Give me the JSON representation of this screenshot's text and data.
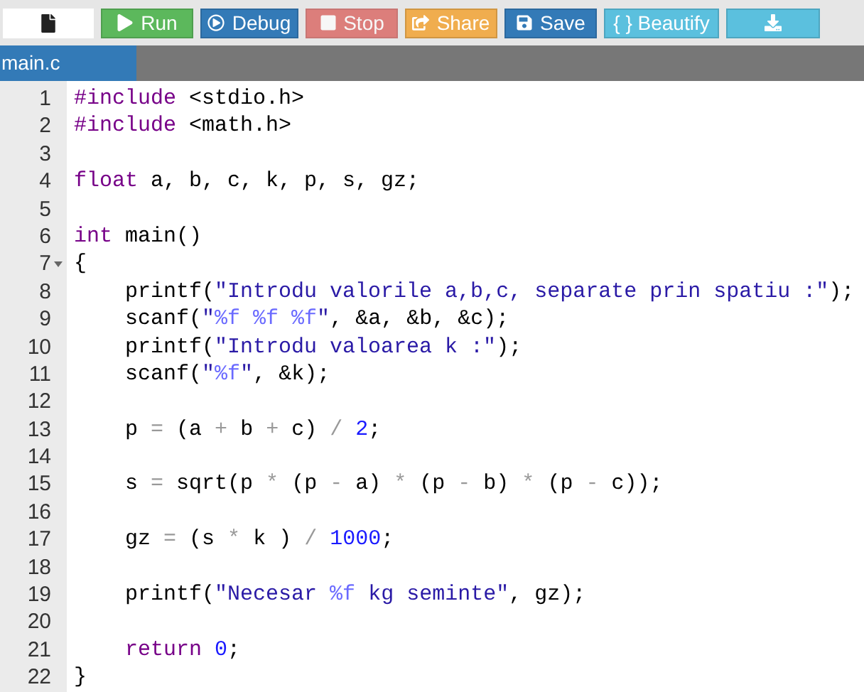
{
  "toolbar": {
    "buttons": [
      {
        "kind": "file",
        "disabled": false
      },
      {
        "kind": "run",
        "label": "Run",
        "disabled": false
      },
      {
        "kind": "debug",
        "label": "Debug",
        "disabled": false
      },
      {
        "kind": "stop",
        "label": "Stop",
        "disabled": true
      },
      {
        "kind": "share",
        "label": "Share",
        "disabled": false
      },
      {
        "kind": "save",
        "label": "Save",
        "disabled": false
      },
      {
        "kind": "beautify",
        "label": "{ } Beautify",
        "disabled": false
      },
      {
        "kind": "download",
        "disabled": false
      }
    ]
  },
  "tabs": [
    {
      "label": "main.c",
      "selected": true
    }
  ],
  "editor": {
    "lines": [
      {
        "number": "1",
        "foldable": false,
        "tokens": [
          {
            "kind": "meta",
            "text": "#include"
          },
          {
            "kind": "plain",
            "text": " <stdio.h>"
          }
        ]
      },
      {
        "number": "2",
        "foldable": false,
        "tokens": [
          {
            "kind": "meta",
            "text": "#include"
          },
          {
            "kind": "plain",
            "text": " <math.h>"
          }
        ]
      },
      {
        "number": "3",
        "foldable": false
      },
      {
        "number": "4",
        "foldable": false,
        "tokens": [
          {
            "kind": "keyword",
            "text": "float"
          },
          {
            "kind": "plain",
            "text": " a, b, c, k, p, s, gz;"
          }
        ]
      },
      {
        "number": "5",
        "foldable": false
      },
      {
        "number": "6",
        "foldable": false,
        "tokens": [
          {
            "kind": "keyword",
            "text": "int"
          },
          {
            "kind": "plain",
            "text": " main()"
          }
        ]
      },
      {
        "number": "7",
        "foldable": true,
        "tokens": [
          {
            "kind": "plain",
            "text": "{"
          }
        ]
      },
      {
        "number": "8",
        "foldable": false,
        "tokens": [
          {
            "kind": "plain",
            "text": "    printf("
          },
          {
            "kind": "string",
            "text": "\"Introdu valorile a,b,c, separate prin spatiu :\""
          },
          {
            "kind": "plain",
            "text": ");"
          }
        ]
      },
      {
        "number": "9",
        "foldable": false,
        "tokens": [
          {
            "kind": "plain",
            "text": "    scanf("
          },
          {
            "kind": "string",
            "text": "\""
          },
          {
            "kind": "format",
            "text": "%f %f %f"
          },
          {
            "kind": "string",
            "text": "\""
          },
          {
            "kind": "plain",
            "text": ", &a, &b, &c);"
          }
        ]
      },
      {
        "number": "10",
        "foldable": false,
        "tokens": [
          {
            "kind": "plain",
            "text": "    printf("
          },
          {
            "kind": "string",
            "text": "\"Introdu valoarea k :\""
          },
          {
            "kind": "plain",
            "text": ");"
          }
        ]
      },
      {
        "number": "11",
        "foldable": false,
        "tokens": [
          {
            "kind": "plain",
            "text": "    scanf("
          },
          {
            "kind": "string",
            "text": "\""
          },
          {
            "kind": "format",
            "text": "%f"
          },
          {
            "kind": "string",
            "text": "\""
          },
          {
            "kind": "plain",
            "text": ", &k);"
          }
        ]
      },
      {
        "number": "12",
        "foldable": false
      },
      {
        "number": "13",
        "foldable": false,
        "tokens": [
          {
            "kind": "plain",
            "text": "    p "
          },
          {
            "kind": "operator",
            "text": "="
          },
          {
            "kind": "plain",
            "text": " (a "
          },
          {
            "kind": "operator",
            "text": "+"
          },
          {
            "kind": "plain",
            "text": " b "
          },
          {
            "kind": "operator",
            "text": "+"
          },
          {
            "kind": "plain",
            "text": " c) "
          },
          {
            "kind": "operator",
            "text": "/"
          },
          {
            "kind": "number",
            "text": " 2"
          },
          {
            "kind": "plain",
            "text": ";"
          }
        ]
      },
      {
        "number": "14",
        "foldable": false
      },
      {
        "number": "15",
        "foldable": false,
        "tokens": [
          {
            "kind": "plain",
            "text": "    s "
          },
          {
            "kind": "operator",
            "text": "="
          },
          {
            "kind": "plain",
            "text": " sqrt(p "
          },
          {
            "kind": "operator",
            "text": "*"
          },
          {
            "kind": "plain",
            "text": " (p "
          },
          {
            "kind": "operator",
            "text": "-"
          },
          {
            "kind": "plain",
            "text": " a) "
          },
          {
            "kind": "operator",
            "text": "*"
          },
          {
            "kind": "plain",
            "text": " (p "
          },
          {
            "kind": "operator",
            "text": "-"
          },
          {
            "kind": "plain",
            "text": " b) "
          },
          {
            "kind": "operator",
            "text": "*"
          },
          {
            "kind": "plain",
            "text": " (p "
          },
          {
            "kind": "operator",
            "text": "-"
          },
          {
            "kind": "plain",
            "text": " c));"
          }
        ]
      },
      {
        "number": "16",
        "foldable": false
      },
      {
        "number": "17",
        "foldable": false,
        "tokens": [
          {
            "kind": "plain",
            "text": "    gz "
          },
          {
            "kind": "operator",
            "text": "="
          },
          {
            "kind": "plain",
            "text": " (s "
          },
          {
            "kind": "operator",
            "text": "*"
          },
          {
            "kind": "plain",
            "text": " k ) "
          },
          {
            "kind": "operator",
            "text": "/"
          },
          {
            "kind": "number",
            "text": " 1000"
          },
          {
            "kind": "plain",
            "text": ";"
          }
        ]
      },
      {
        "number": "18",
        "foldable": false
      },
      {
        "number": "19",
        "foldable": false,
        "tokens": [
          {
            "kind": "plain",
            "text": "    printf("
          },
          {
            "kind": "string",
            "text": "\"Necesar "
          },
          {
            "kind": "format",
            "text": "%f"
          },
          {
            "kind": "string",
            "text": " kg seminte\""
          },
          {
            "kind": "plain",
            "text": ", gz);"
          }
        ]
      },
      {
        "number": "20",
        "foldable": false
      },
      {
        "number": "21",
        "foldable": false,
        "tokens": [
          {
            "kind": "keyword",
            "text": "    return"
          },
          {
            "kind": "number",
            "text": " 0"
          },
          {
            "kind": "plain",
            "text": ";"
          }
        ]
      },
      {
        "number": "22",
        "foldable": false,
        "tokens": [
          {
            "kind": "plain",
            "text": "}"
          }
        ]
      }
    ]
  }
}
